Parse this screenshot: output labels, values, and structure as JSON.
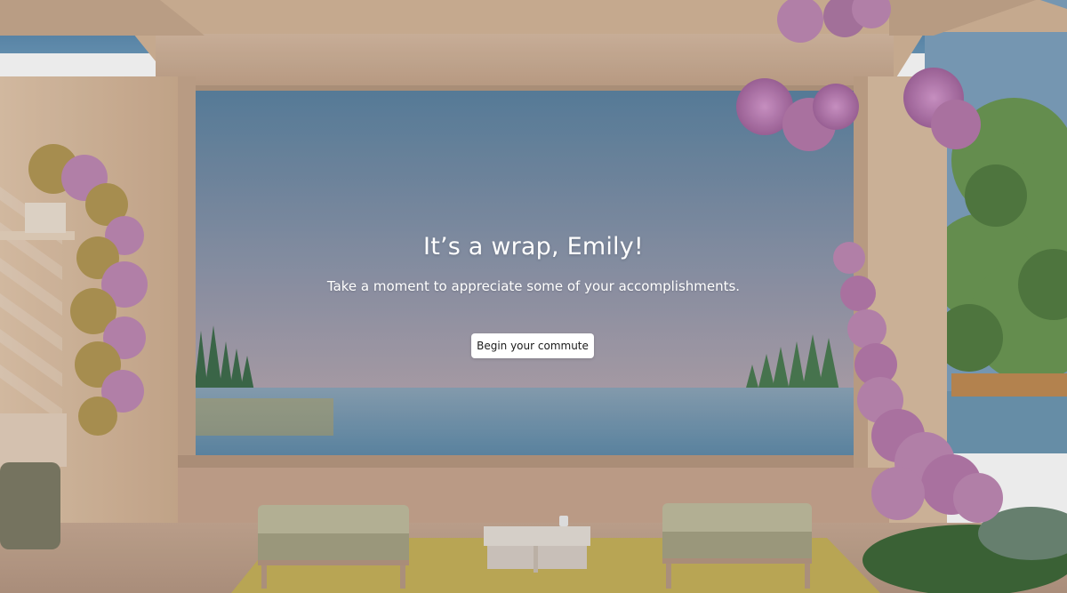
{
  "screen": {
    "headline": "It’s a wrap, Emily!",
    "message": "Take a moment to appreciate some of your accomplishments.",
    "cta_label": "Begin your commute"
  },
  "colors": {
    "sky_top": "#5d86a4",
    "sky_bottom": "#a9a3b0",
    "water": "#6a93ad",
    "wall": "#d9b99c",
    "flowers": "#c07fb5",
    "foliage": "#6f9a58",
    "rug": "#c9b155"
  },
  "icons": [
    "decorative-flower-vines",
    "trees",
    "bench",
    "coffee-table"
  ]
}
